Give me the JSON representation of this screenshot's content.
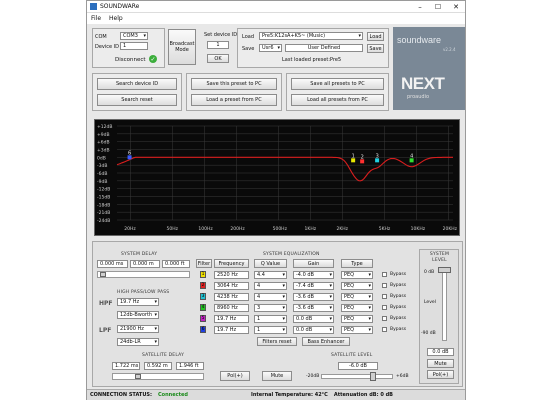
{
  "window": {
    "title": "SOUNDWARe"
  },
  "menu": {
    "file": "File",
    "help": "Help"
  },
  "connection": {
    "com_label": "COM",
    "com_value": "COM3",
    "device_id_label": "Device ID",
    "device_id_value": "1",
    "disconnect": "Disconnect",
    "broadcast_mode": "Broadcast Mode"
  },
  "set_device_id": {
    "label": "Set device ID",
    "value": "1",
    "ok": "OK"
  },
  "preset": {
    "load_label": "Load",
    "load_value": "Pre5:K12sA+K5~ (Music)",
    "load_button": "Load",
    "save_label": "Save",
    "save_slot": "Usr6",
    "save_name": "User Defined",
    "save_button": "Save",
    "last_loaded": "Last loaded preset:Pre5"
  },
  "logo": {
    "brand": "soundware",
    "version": "v2.2.4",
    "next": "NEXT",
    "sub": "proaudio"
  },
  "actions": {
    "search_device": "Search device ID",
    "search_reset": "Search reset",
    "save_preset_pc": "Save this preset to PC",
    "load_preset_pc": "Load a preset from PC",
    "save_all_presets": "Save all presets to PC",
    "load_all_presets": "Load all presets from PC"
  },
  "graph": {
    "y_labels": [
      "+12dB",
      "+9dB",
      "+6dB",
      "+3dB",
      "0dB",
      "-3dB",
      "-6dB",
      "-9dB",
      "-12dB",
      "-15dB",
      "-18dB",
      "-21dB",
      "-24dB"
    ],
    "x_labels": [
      "20Hz",
      "50Hz",
      "100Hz",
      "200Hz",
      "500Hz",
      "1KHz",
      "2KHz",
      "5KHz",
      "10KHz",
      "20KHz"
    ],
    "markers": [
      {
        "label": "6",
        "color": "#3a5bff"
      },
      {
        "label": "1",
        "color": "#e8e800"
      },
      {
        "label": "2",
        "color": "#ff3030"
      },
      {
        "label": "3",
        "color": "#20d0e0"
      },
      {
        "label": "4",
        "color": "#30e030"
      }
    ]
  },
  "system_delay": {
    "title": "SYSTEM DELAY",
    "values": [
      "0.000 ms",
      "0.000 m",
      "0.000 ft"
    ]
  },
  "hpf_lpf": {
    "title": "HIGH PASS/LOW PASS",
    "hpf_label": "HPF",
    "hpf_freq": "19.7 Hz",
    "hpf_type": "12db-Bworth",
    "lpf_label": "LPF",
    "lpf_freq": "21900 Hz",
    "lpf_type": "24db-LR"
  },
  "eq": {
    "title": "SYSTEM EQUALIZATION",
    "headers": [
      "Filter",
      "Frequency",
      "Q Value",
      "Gain",
      "Type"
    ],
    "rows": [
      {
        "n": "1",
        "color": "#f0e000",
        "freq": "2520 Hz",
        "q": "4.4",
        "gain": "-4.0 dB",
        "type": "PEQ",
        "bypass": "Bypass"
      },
      {
        "n": "2",
        "color": "#e02020",
        "freq": "3064 Hz",
        "q": "4",
        "gain": "-7.4 dB",
        "type": "PEQ",
        "bypass": "Bypass"
      },
      {
        "n": "3",
        "color": "#20c0d0",
        "freq": "4238 Hz",
        "q": "4",
        "gain": "-3.6 dB",
        "type": "PEQ",
        "bypass": "Bypass"
      },
      {
        "n": "4",
        "color": "#20c020",
        "freq": "8960 Hz",
        "q": "3",
        "gain": "-3.6 dB",
        "type": "PEQ",
        "bypass": "Bypass"
      },
      {
        "n": "5",
        "color": "#c020c0",
        "freq": "19.7 Hz",
        "q": "1",
        "gain": "0.0 dB",
        "type": "PEQ",
        "bypass": "Bypass"
      },
      {
        "n": "6",
        "color": "#2040e0",
        "freq": "19.7 Hz",
        "q": "1",
        "gain": "0.0 dB",
        "type": "PEQ",
        "bypass": "Bypass"
      }
    ],
    "filters_reset": "Filters reset",
    "bass_enhancer": "Bass Enhancer"
  },
  "system_level": {
    "title": "SYSTEM LEVEL",
    "top": "0 dB",
    "mid": "Level",
    "bottom": "-90 dB",
    "value": "0.0 dB",
    "mute": "Mute",
    "pol": "Pol(+)"
  },
  "satellite": {
    "delay_title": "SATELLITE DELAY",
    "delay_values": [
      "1.722 ms",
      "0.592 m",
      "1.946 ft"
    ],
    "pol": "Pol(+)",
    "mute": "Mute",
    "level_title": "SATELLITE LEVEL",
    "level_value": "-6.0 dB",
    "level_min": "-20dB",
    "level_max": "+6dB"
  },
  "status": {
    "connection_label": "CONNECTION STATUS:",
    "connection_value": "Connected",
    "temperature": "Internal Temperature: 42°C",
    "attenuation": "Attenuation dB: 0 dB"
  }
}
